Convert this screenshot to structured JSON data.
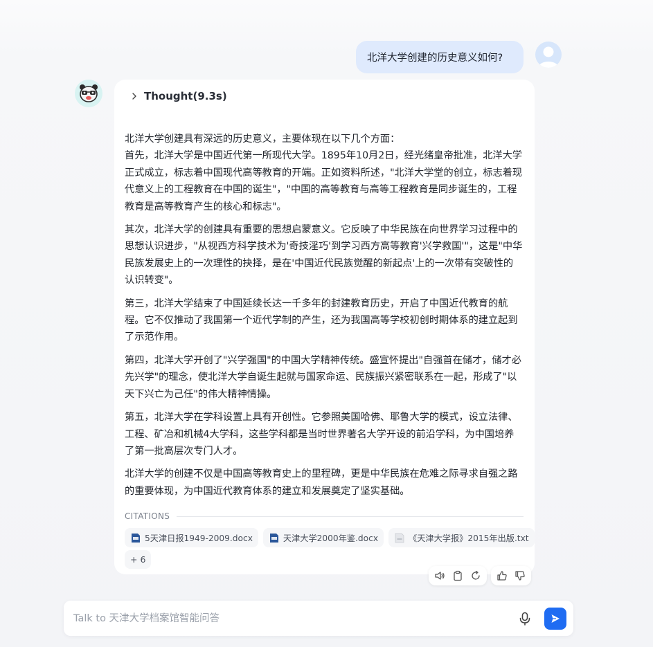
{
  "user_message": "北洋大学创建的历史意义如何?",
  "answer": {
    "thought_label": "Thought(9.3s)",
    "paragraphs": [
      "北洋大学创建具有深远的历史意义，主要体现在以下几个方面：",
      "首先，北洋大学是中国近代第一所现代大学。1895年10月2日，经光绪皇帝批准，北洋大学正式成立，标志着中国现代高等教育的开端。正如资料所述，\"北洋大学堂的创立，标志着现代意义上的工程教育在中国的诞生\"，\"中国的高等教育与高等工程教育是同步诞生的，工程教育是高等教育产生的核心和标志\"。",
      "其次，北洋大学的创建具有重要的思想启蒙意义。它反映了中华民族在向世界学习过程中的思想认识进步，\"从视西方科学技术为'奇技淫巧'到学习西方高等教育'兴学救国'\"，这是\"中华民族发展史上的一次理性的抉择，是在'中国近代民族觉醒的新起点'上的一次带有突破性的认识转变\"。",
      "第三，北洋大学结束了中国延续长达一千多年的封建教育历史，开启了中国近代教育的航程。它不仅推动了我国第一个近代学制的产生，还为我国高等学校初创时期体系的建立起到了示范作用。",
      "第四，北洋大学开创了\"兴学强国\"的中国大学精神传统。盛宣怀提出\"自强首在储才，储才必先兴学\"的理念，使北洋大学自诞生起就与国家命运、民族振兴紧密联系在一起，形成了\"以天下兴亡为己任\"的伟大精神情操。",
      "第五，北洋大学在学科设置上具有开创性。它参照美国哈佛、耶鲁大学的模式，设立法律、工程、矿冶和机械4大学科，这些学科都是当时世界著名大学开设的前沿学科，为中国培养了第一批高层次专门人才。",
      "北洋大学的创建不仅是中国高等教育史上的里程碑，更是中华民族在危难之际寻求自强之路的重要体现，为中国近代教育体系的建立和发展奠定了坚实基础。"
    ],
    "citations_label": "CITATIONS",
    "citations": [
      {
        "name": "5天津日报1949-2009.docx",
        "icon": "docx-icon"
      },
      {
        "name": "天津大学2000年鉴.docx",
        "icon": "docx-icon"
      },
      {
        "name": "《天津大学报》2015年出版.txt",
        "icon": "txt-file-icon"
      }
    ],
    "more_citations": "+ 6"
  },
  "composer": {
    "placeholder": "Talk to 天津大学档案馆智能问答"
  },
  "colors": {
    "accent": "#1f6cf2",
    "user_bubble": "#dfeafd",
    "docx_icon": "#2b579a"
  }
}
